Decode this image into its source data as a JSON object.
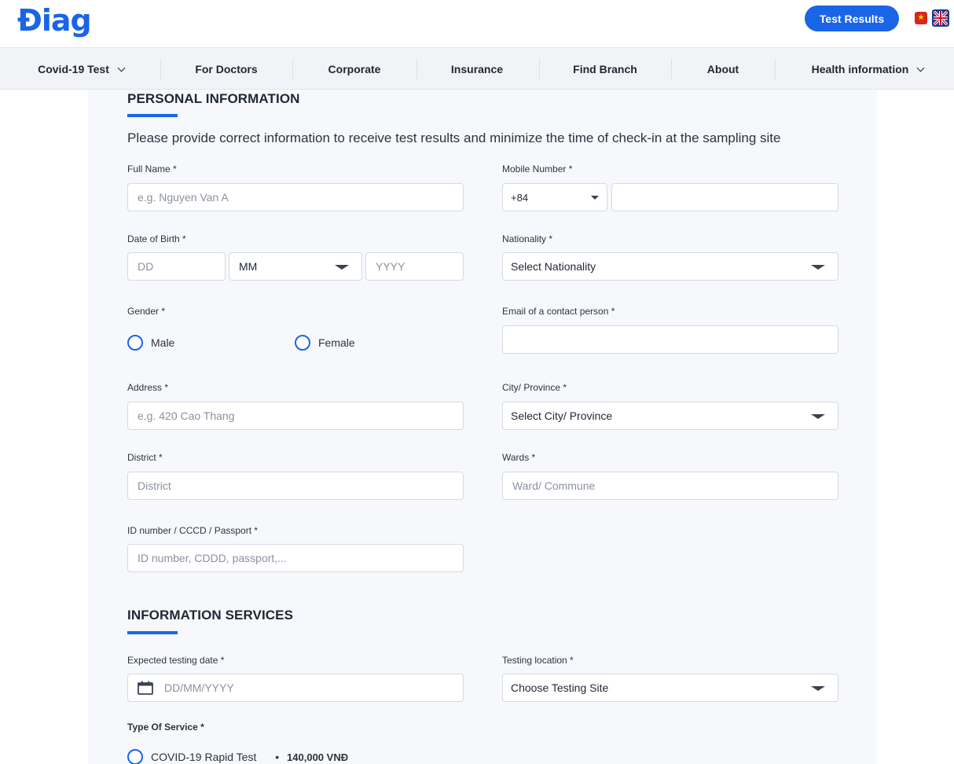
{
  "header": {
    "logo": "Điag",
    "test_results_button": "Test Results",
    "flag_vn_icon": "vietnam-flag-icon",
    "flag_uk_icon": "uk-flag-icon"
  },
  "nav": {
    "items": [
      {
        "label": "Covid-19 Test",
        "dropdown": true
      },
      {
        "label": "For Doctors",
        "dropdown": false
      },
      {
        "label": "Corporate",
        "dropdown": false
      },
      {
        "label": "Insurance",
        "dropdown": false
      },
      {
        "label": "Find Branch",
        "dropdown": false
      },
      {
        "label": "About",
        "dropdown": false
      },
      {
        "label": "Health information",
        "dropdown": true
      }
    ]
  },
  "personal": {
    "title": "PERSONAL INFORMATION",
    "intro": "Please provide correct information to receive test results and minimize the time of check-in at the sampling site",
    "full_name": {
      "label": "Full Name  *",
      "placeholder": "e.g. Nguyen Van A"
    },
    "mobile": {
      "label": "Mobile Number  *",
      "country_code": "+84",
      "value": ""
    },
    "dob": {
      "label": "Date of Birth  *",
      "day_placeholder": "DD",
      "month_value": "MM",
      "year_placeholder": "YYYY"
    },
    "nationality": {
      "label": "Nationality  *",
      "value": "Select Nationality"
    },
    "gender": {
      "label": "Gender  *",
      "options": [
        "Male",
        "Female"
      ]
    },
    "email": {
      "label": "Email of a contact person  *",
      "value": ""
    },
    "address": {
      "label": "Address  *",
      "placeholder": "e.g. 420 Cao Thang"
    },
    "city": {
      "label": "City/ Province  *",
      "value": "Select City/ Province"
    },
    "district": {
      "label": "District  *",
      "placeholder": "District"
    },
    "wards": {
      "label": "Wards  *",
      "placeholder": "Ward/ Commune"
    },
    "id_number": {
      "label": "ID number / CCCD / Passport  *",
      "placeholder": "ID number, CDDD, passport,..."
    }
  },
  "services": {
    "title": "INFORMATION SERVICES",
    "testing_date": {
      "label": "Expected testing date  *",
      "placeholder": "DD/MM/YYYY",
      "icon": "calendar-icon"
    },
    "testing_location": {
      "label": "Testing location  *",
      "value": "Choose Testing Site"
    },
    "service_type": {
      "label": "Type Of Service  *",
      "option": "COVID-19 Rapid Test",
      "bullet": "•",
      "price": "140,000 VNĐ"
    }
  },
  "colors": {
    "accent": "#1a64e8",
    "panel": "#f6f8fc",
    "nav_bg": "#f1f3f6"
  }
}
